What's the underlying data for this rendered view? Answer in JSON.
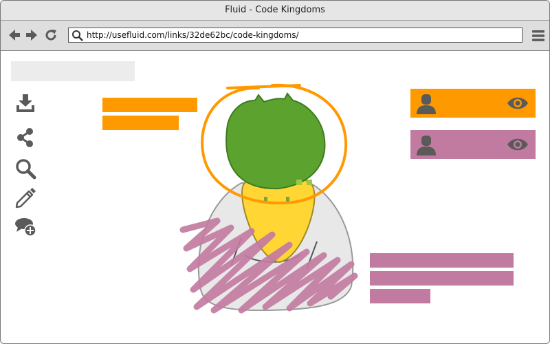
{
  "window": {
    "title": "Fluid - Code Kingdoms"
  },
  "navigation": {
    "back_icon": "arrow-left-icon",
    "forward_icon": "arrow-right-icon",
    "reload_icon": "reload-icon",
    "menu_icon": "hamburger-menu-icon"
  },
  "address_bar": {
    "url": "http://usefluid.com/links/32de62bc/code-kingdoms/",
    "icon": "search-icon"
  },
  "toolbar": {
    "tools": [
      "download-icon",
      "share-icon",
      "search-icon",
      "pencil-icon",
      "add-comment-icon"
    ]
  },
  "users": [
    {
      "color": "#ff9900",
      "icons": [
        "user-icon",
        "eye-icon"
      ]
    },
    {
      "color": "#c27ba0",
      "icons": [
        "user-icon",
        "eye-icon"
      ]
    }
  ],
  "colors": {
    "orange_highlight": "#ff9900",
    "pink_highlight": "#c27ba0",
    "placeholder_grey": "#ececec",
    "icon_grey": "#5a5a5a",
    "duck_head_green": "#5ba32e",
    "duck_beak_yellow": "#ffd633"
  }
}
